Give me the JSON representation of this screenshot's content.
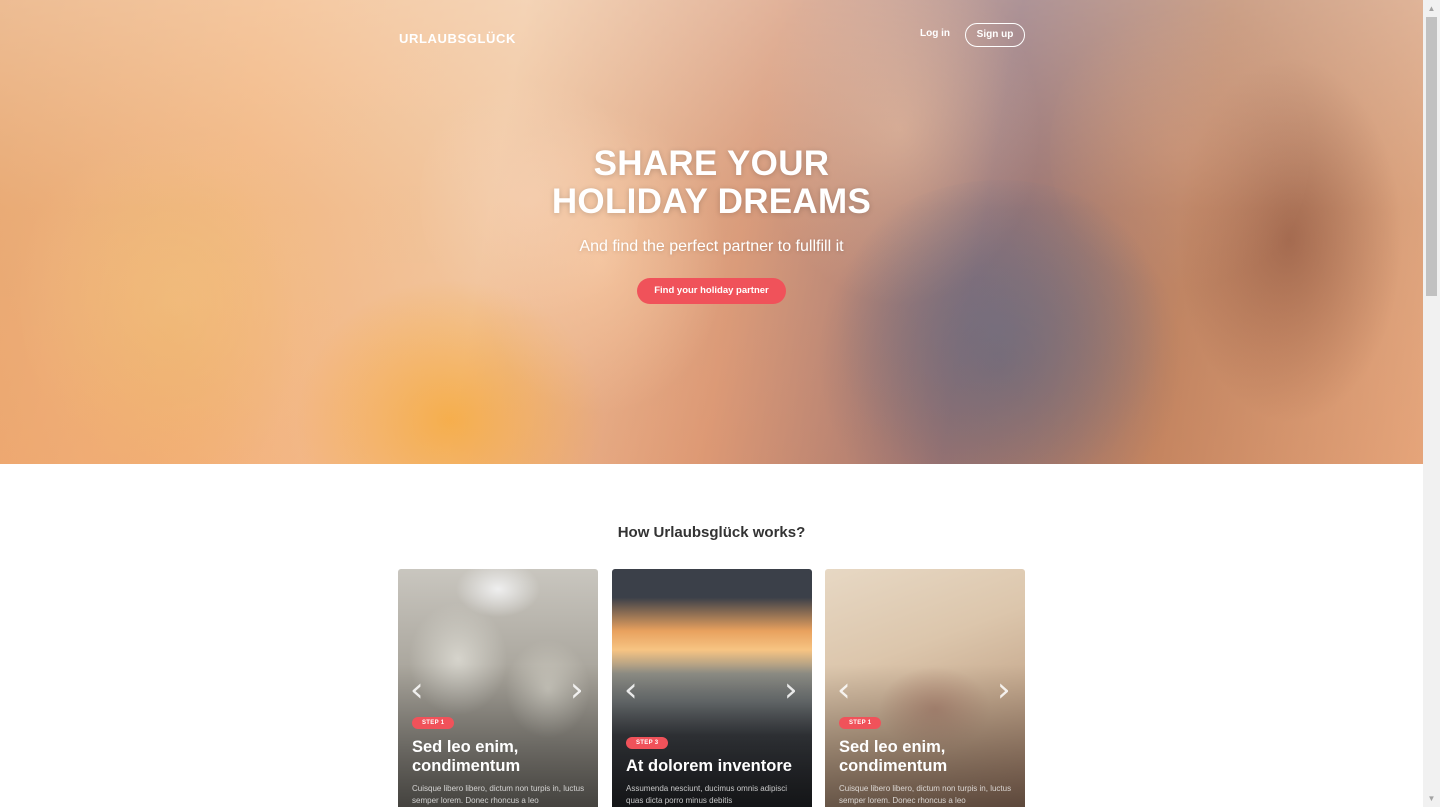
{
  "header": {
    "brand": "URLAUBSGLÜCK",
    "login_label": "Log in",
    "signup_label": "Sign up"
  },
  "hero": {
    "headline_line1": "SHARE YOUR",
    "headline_line2": "HOLIDAY DREAMS",
    "subline": "And find the perfect partner to fullfill it",
    "cta_label": "Find your holiday partner"
  },
  "how_it_works": {
    "title": "How Urlaubsglück works?",
    "cards": [
      {
        "step": "STEP 1",
        "title": "Sed leo enim, condimentum",
        "text": "Cuisque libero libero, dictum non turpis in, luctus semper lorem. Donec rhoncus a leo",
        "prev_icon": "chevron-left-icon",
        "next_icon": "chevron-right-icon"
      },
      {
        "step": "STEP 3",
        "title": "At dolorem inventore",
        "text": "Assumenda nesciunt, ducimus omnis adipisci quas dicta porro minus debitis",
        "prev_icon": "chevron-left-icon",
        "next_icon": "chevron-right-icon"
      },
      {
        "step": "STEP 1",
        "title": "Sed leo enim, condimentum",
        "text": "Cuisque libero libero, dictum non turpis in, luctus semper lorem. Donec rhoncus a leo",
        "prev_icon": "chevron-left-icon",
        "next_icon": "chevron-right-icon"
      }
    ]
  },
  "colors": {
    "accent": "#f0525a",
    "text_dark": "#333333"
  }
}
